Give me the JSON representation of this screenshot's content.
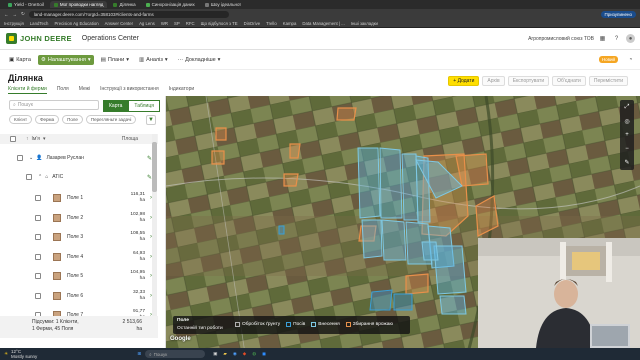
{
  "browser": {
    "tabs": [
      {
        "label": "Yield - OneSoil",
        "color": "#3ba55c"
      },
      {
        "label": "Мої проводки нагляд",
        "color": "#367c2b",
        "active": true
      },
      {
        "label": "Ділянка",
        "color": "#367c2b"
      },
      {
        "label": "Синхронізація даних",
        "color": "#4caf50"
      },
      {
        "label": "Шоу ідеальної",
        "color": "#777"
      }
    ],
    "url": "land-manager.deere.com/?orgId=358103#/clients-and-farms",
    "profile_label": "Призупинено",
    "bookmarks": [
      "Інструкція",
      "LandTech",
      "Precision Ag Education",
      "Answer Center",
      "Ag Lens",
      "WR",
      "SP",
      "RFC",
      "Що відбулося з TE",
      "DinDrive",
      "Trello",
      "Kampa",
      "Data Management | ...",
      "Інші закладки"
    ]
  },
  "header": {
    "brand": "JOHN DEERE",
    "app": "Operations Center",
    "org": "Агропромисловий союз ТОВ",
    "new_badge": "Новий"
  },
  "nav": [
    {
      "label": "Карта",
      "icon": "map-icon"
    },
    {
      "label": "Налаштування",
      "icon": "settings-icon",
      "active": true
    },
    {
      "label": "Плани",
      "icon": "plans-icon"
    },
    {
      "label": "Аналіз",
      "icon": "analyze-icon"
    },
    {
      "label": "Докладніше",
      "icon": "more-icon"
    }
  ],
  "page": {
    "title": "Ділянка",
    "subtabs": [
      "Клієнти й ферми",
      "Поля",
      "Межі",
      "Інструкції з використання",
      "Індикатори"
    ],
    "actions": {
      "add": "+ Додати",
      "archive": "Архів",
      "export": "Експортувати",
      "merge": "Об'єднати",
      "move": "Перемістити"
    }
  },
  "panel": {
    "search_placeholder": "Пошук",
    "view_map": "Карта",
    "view_table": "Таблиця",
    "chips": [
      "Клієнт",
      "Ферма",
      "Поле",
      "Перегляньте задачі"
    ],
    "col_name": "Ім'я",
    "col_area": "Площа",
    "client": "Лазарев Руслан",
    "farm": "АТІС",
    "fields": [
      {
        "name": "Поле 1",
        "area": "116,31",
        "unit": "ha"
      },
      {
        "name": "Поле 2",
        "area": "102,98",
        "unit": "ha"
      },
      {
        "name": "Поле 3",
        "area": "108,55",
        "unit": "ha"
      },
      {
        "name": "Поле 4",
        "area": "64,93",
        "unit": "ha"
      },
      {
        "name": "Поле 5",
        "area": "104,95",
        "unit": "ha"
      },
      {
        "name": "Поле 6",
        "area": "32,33",
        "unit": "ha"
      },
      {
        "name": "Поле 7",
        "area": "91,77",
        "unit": "ha"
      }
    ],
    "totals_label1": "Підсумки: 1 Клієнти,",
    "totals_label2": "1 Ферми, 45 Поля",
    "totals_value": "2 513,66",
    "totals_unit": "ha"
  },
  "map": {
    "legend_title": "Поле",
    "legend_subtitle": "Останній тип роботи",
    "legend_items": [
      {
        "label": "Обробіток ґрунту",
        "color": "#b0b0b0"
      },
      {
        "label": "Посів",
        "color": "#3aa0d8"
      },
      {
        "label": "Внесення",
        "color": "#7ec8e3"
      },
      {
        "label": "Збирання врожаю",
        "color": "#e8904a"
      }
    ],
    "google": "Google"
  },
  "taskbar": {
    "weather_temp": "12°C",
    "weather_text": "Mostly sunny",
    "search": "Пошук"
  },
  "colors": {
    "brand_green": "#367c2b",
    "brand_yellow": "#ffde00"
  }
}
